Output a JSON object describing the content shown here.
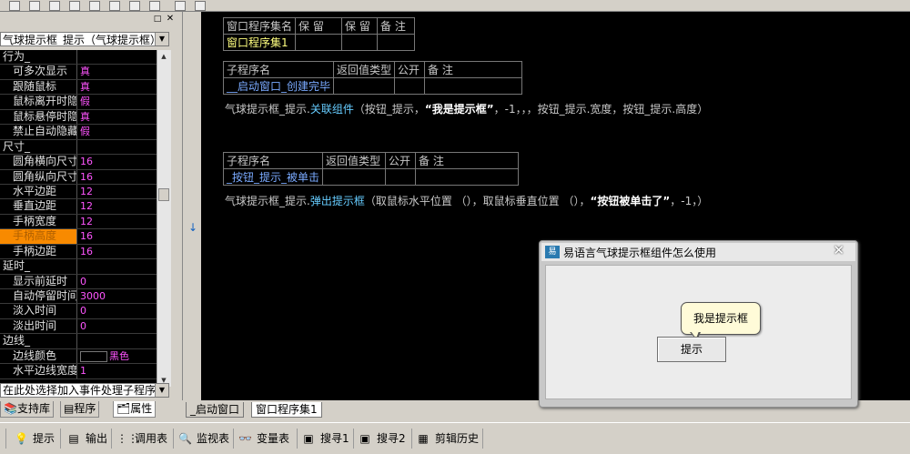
{
  "property_panel": {
    "object_selector": "气球提示框_提示（气球提示框）",
    "rows": [
      {
        "name": "行为_",
        "value": "",
        "category": true
      },
      {
        "name": "可多次显示",
        "value": "真"
      },
      {
        "name": "跟随鼠标",
        "value": "真"
      },
      {
        "name": "鼠标离开时隐",
        "value": "假"
      },
      {
        "name": "鼠标悬停时隐",
        "value": "真"
      },
      {
        "name": "禁止自动隐藏",
        "value": "假"
      },
      {
        "name": "尺寸_",
        "value": "",
        "category": true
      },
      {
        "name": "圆角横向尺寸",
        "value": "16"
      },
      {
        "name": "圆角纵向尺寸",
        "value": "16"
      },
      {
        "name": "水平边距",
        "value": "12"
      },
      {
        "name": "垂直边距",
        "value": "12"
      },
      {
        "name": "手柄宽度",
        "value": "12"
      },
      {
        "name": "手柄高度",
        "value": "16",
        "selected": true
      },
      {
        "name": "手柄边距",
        "value": "16"
      },
      {
        "name": "延时_",
        "value": "",
        "category": true
      },
      {
        "name": "显示前延时",
        "value": "0"
      },
      {
        "name": "自动停留时间",
        "value": "3000"
      },
      {
        "name": "淡入时间",
        "value": "0"
      },
      {
        "name": "淡出时间",
        "value": "0"
      },
      {
        "name": "边线_",
        "value": "",
        "category": true
      },
      {
        "name": "边线颜色",
        "value": "黑色",
        "swatch": true
      },
      {
        "name": "水平边线宽度",
        "value": "1"
      }
    ],
    "event_selector": "在此处选择加入事件处理子程序",
    "tabs": [
      "支持库",
      "程序",
      "属性"
    ]
  },
  "editor": {
    "table1": {
      "headers": [
        "窗口程序集名",
        "保 留",
        "保 留",
        "备 注"
      ],
      "row": [
        "窗口程序集1",
        "",
        "",
        ""
      ]
    },
    "table2": {
      "headers": [
        "子程序名",
        "返回值类型",
        "公开",
        "备 注"
      ],
      "row": [
        "__启动窗口_创建完毕",
        "",
        "",
        ""
      ]
    },
    "code1": {
      "obj": "气球提示框_提示.",
      "method": "关联组件",
      "args1": "（按钮_提示，",
      "str": "“我是提示框”",
      "args2": "，-1，，，按钮_提示.宽度，按钮_提示.高度）"
    },
    "table3": {
      "headers": [
        "子程序名",
        "返回值类型",
        "公开",
        "备 注"
      ],
      "row": [
        "_按钮_提示_被单击",
        "",
        "",
        ""
      ]
    },
    "code2": {
      "obj": "气球提示框_提示.",
      "method": "弹出提示框",
      "args1": "（取鼠标水平位置 （），取鼠标垂直位置 （），",
      "str": "“按钮被单击了”",
      "args2": "，-1，）"
    },
    "tabs": [
      "_启动窗口",
      "窗口程序集1"
    ]
  },
  "popup": {
    "title": "易语言气球提示框组件怎么使用",
    "balloon_text": "我是提示框",
    "button_label": "提示"
  },
  "bottom_toolbar": [
    "提示",
    "输出",
    "调用表",
    "监视表",
    "变量表",
    "搜寻1",
    "搜寻2",
    "剪辑历史"
  ]
}
